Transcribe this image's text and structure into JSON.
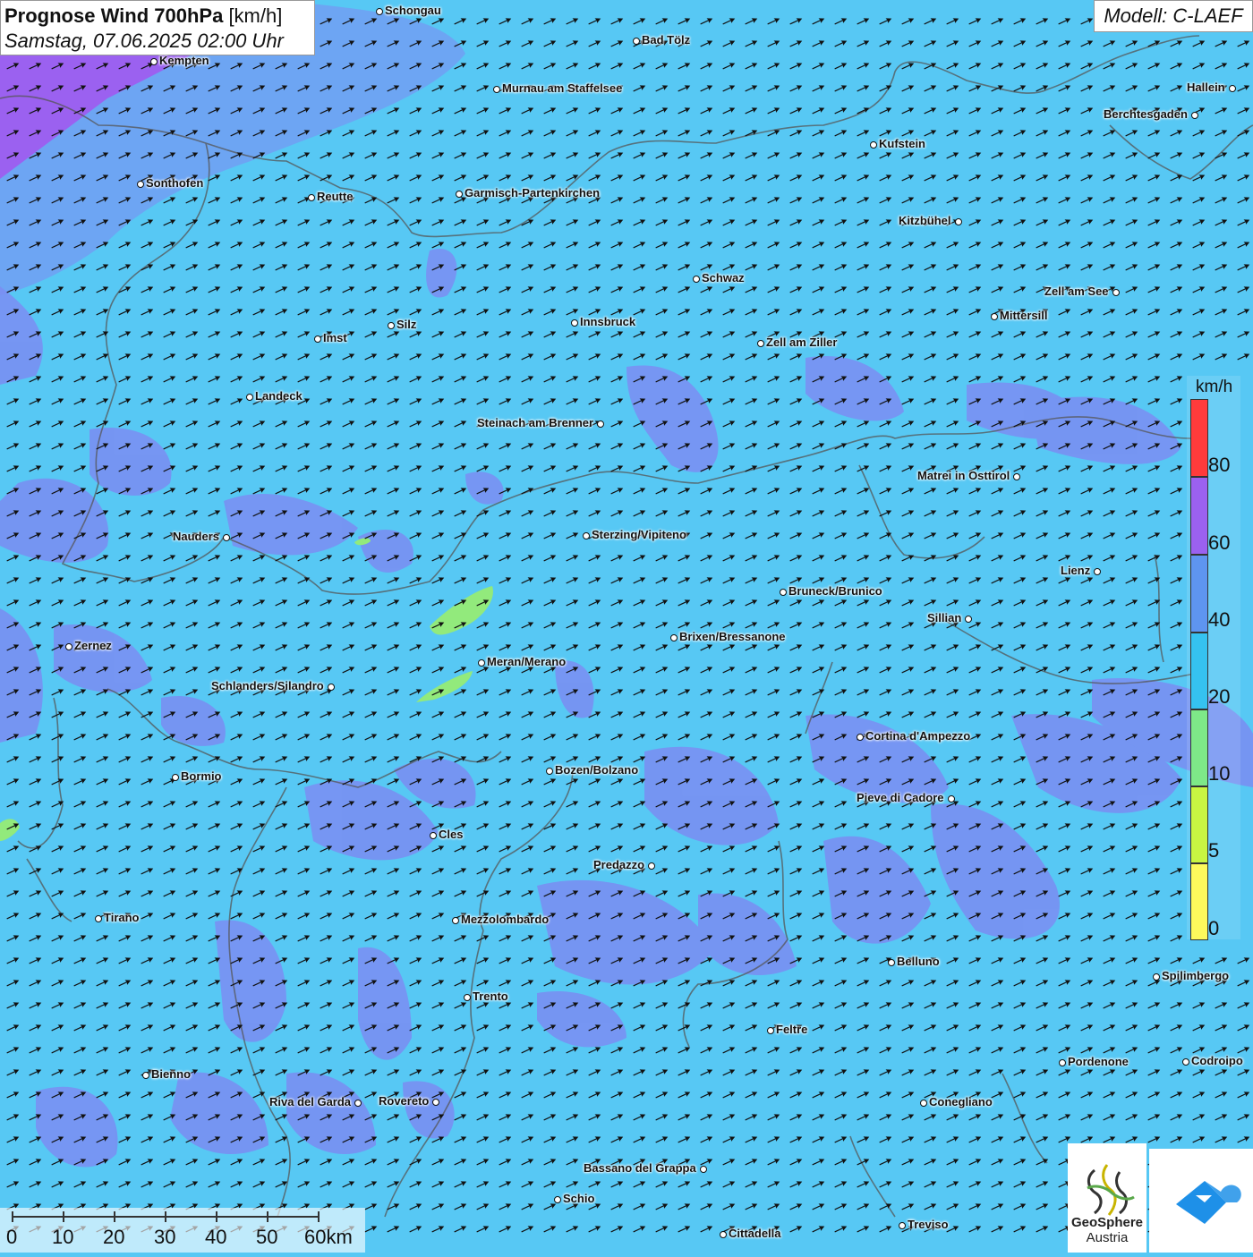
{
  "header": {
    "title_bold": "Prognose Wind 700hPa",
    "title_unit": "[km/h]",
    "datetime": "Samstag, 07.06.2025 02:00 Uhr",
    "model": "Modell: C-LAEF"
  },
  "legend": {
    "unit": "km/h",
    "ticks": [
      "80",
      "60",
      "40",
      "20",
      "10",
      "5",
      "0"
    ],
    "colors": [
      "#ff3b3b",
      "#9b61f0",
      "#5e95f0",
      "#35c2f0",
      "#7ee888",
      "#c8f542",
      "#fdf95c"
    ]
  },
  "scalebar": {
    "labels": [
      "0",
      "10",
      "20",
      "30",
      "40",
      "50",
      "60km"
    ]
  },
  "logos": {
    "geosphere_line1": "GeoSphere",
    "geosphere_line2": "Austria"
  },
  "cities": [
    {
      "name": "Schongau"
    },
    {
      "name": "Bad Tölz"
    },
    {
      "name": "Kempten"
    },
    {
      "name": "Murnau am Staffelsee"
    },
    {
      "name": "Hallein"
    },
    {
      "name": "Berchtesgaden"
    },
    {
      "name": "Kufstein"
    },
    {
      "name": "Sonthofen"
    },
    {
      "name": "Reutte"
    },
    {
      "name": "Garmisch-Partenkirchen"
    },
    {
      "name": "Kitzbühel"
    },
    {
      "name": "Schwaz"
    },
    {
      "name": "Zell am See"
    },
    {
      "name": "Mittersill"
    },
    {
      "name": "Innsbruck"
    },
    {
      "name": "Silz"
    },
    {
      "name": "Imst"
    },
    {
      "name": "Zell am Ziller"
    },
    {
      "name": "Landeck"
    },
    {
      "name": "Steinach am Brenner"
    },
    {
      "name": "Matrei in Osttirol"
    },
    {
      "name": "Nauders"
    },
    {
      "name": "Sterzing/Vipiteno"
    },
    {
      "name": "Lienz"
    },
    {
      "name": "Bruneck/Brunico"
    },
    {
      "name": "Sillian"
    },
    {
      "name": "Zernez"
    },
    {
      "name": "Brixen/Bressanone"
    },
    {
      "name": "Meran/Merano"
    },
    {
      "name": "Schlanders/Silandro"
    },
    {
      "name": "Cortina d'Ampezzo"
    },
    {
      "name": "Bozen/Bolzano"
    },
    {
      "name": "Bormio"
    },
    {
      "name": "Pieve di Cadore"
    },
    {
      "name": "Cles"
    },
    {
      "name": "Predazzo"
    },
    {
      "name": "Tirano"
    },
    {
      "name": "Mezzolombardo"
    },
    {
      "name": "Belluno"
    },
    {
      "name": "Spilimbergo"
    },
    {
      "name": "Trento"
    },
    {
      "name": "Feltre"
    },
    {
      "name": "Pordenone"
    },
    {
      "name": "Codroipo"
    },
    {
      "name": "Bienno"
    },
    {
      "name": "Riva del Garda"
    },
    {
      "name": "Rovereto"
    },
    {
      "name": "Conegliano"
    },
    {
      "name": "Bassano del Grappa"
    },
    {
      "name": "Schio"
    },
    {
      "name": "Treviso"
    },
    {
      "name": "Cittadella"
    }
  ],
  "colors": {
    "wind_20_40": "#57c8f4",
    "wind_40_60": "#7b8df2",
    "wind_60_80": "#9b61f0",
    "wind_10_20": "#92ea7c"
  }
}
